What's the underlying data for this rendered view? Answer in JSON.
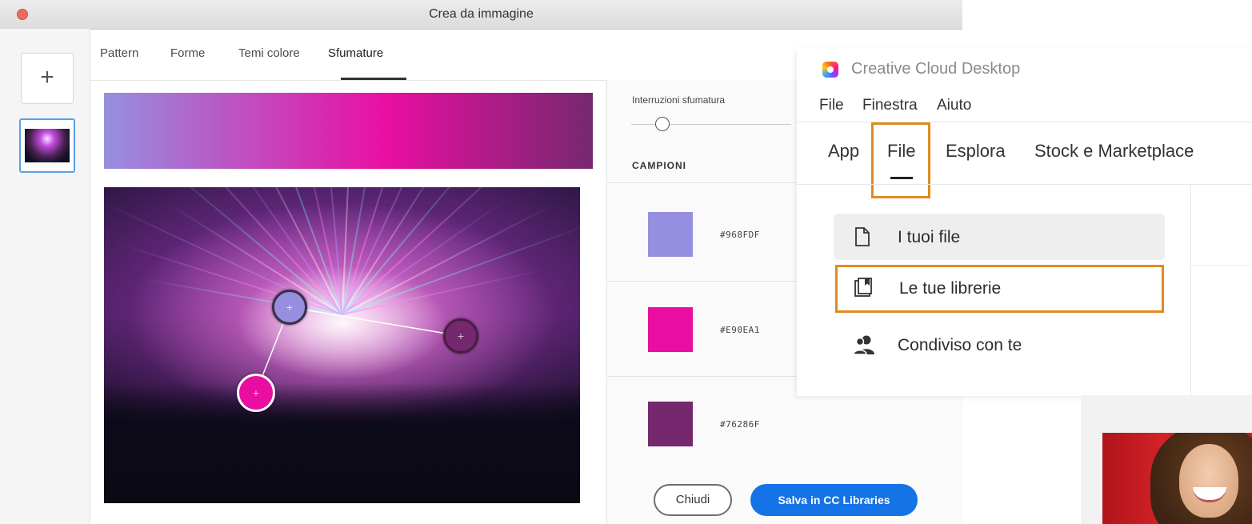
{
  "window": {
    "title": "Crea da immagine"
  },
  "tabs": [
    "Pattern",
    "Forme",
    "Temi colore",
    "Sfumature"
  ],
  "active_tab": "Sfumature",
  "add_label": "+",
  "gradient": {
    "stops_label": "Interruzioni sfumatura",
    "colors": [
      "#968FDF",
      "#E90EA1",
      "#76286F"
    ]
  },
  "swatches": {
    "header": "CAMPIONI",
    "items": [
      {
        "hex": "#968FDF",
        "color": "#968FDF"
      },
      {
        "hex": "#E90EA1",
        "color": "#E90EA1"
      },
      {
        "hex": "#76286F",
        "color": "#76286F"
      }
    ]
  },
  "buttons": {
    "close": "Chiudi",
    "save": "Salva in CC Libraries"
  },
  "cc": {
    "title": "Creative Cloud Desktop",
    "menu": [
      "File",
      "Finestra",
      "Aiuto"
    ],
    "tabs": [
      "App",
      "File",
      "Esplora",
      "Stock e Marketplace"
    ],
    "active_tab": "File",
    "items": [
      {
        "label": "I tuoi file",
        "icon": "document-icon"
      },
      {
        "label": "Le tue librerie",
        "icon": "library-icon"
      },
      {
        "label": "Condiviso con te",
        "icon": "people-icon"
      }
    ]
  },
  "highlight_color": "#e08b1e",
  "accent_color": "#1473e6"
}
